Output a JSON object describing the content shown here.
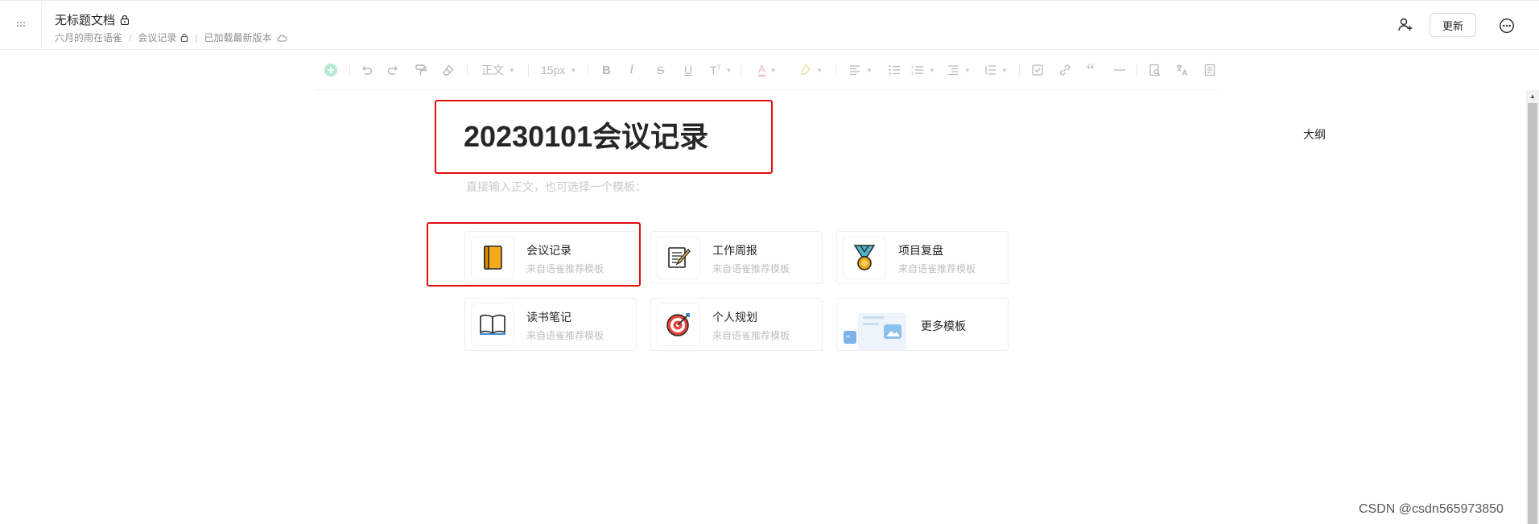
{
  "header": {
    "doc_title": "无标题文档",
    "breadcrumb": {
      "space": "六月的雨在语雀",
      "book": "会议记录",
      "status": "已加载最新版本"
    },
    "update_label": "更新"
  },
  "toolbar": {
    "paragraph_style": "正文",
    "font_size": "15px"
  },
  "editor": {
    "title": "20230101会议记录",
    "placeholder": "直接输入正文，也可选择一个模板："
  },
  "outline_label": "大纲",
  "templates": [
    {
      "name": "会议记录",
      "source": "来自语雀推荐模板",
      "icon": "notebook-icon"
    },
    {
      "name": "工作周报",
      "source": "来自语雀推荐模板",
      "icon": "memo-icon"
    },
    {
      "name": "项目复盘",
      "source": "来自语雀推荐模板",
      "icon": "medal-icon"
    },
    {
      "name": "读书笔记",
      "source": "来自语雀推荐模板",
      "icon": "open-book-icon"
    },
    {
      "name": "个人规划",
      "source": "来自语雀推荐模板",
      "icon": "target-icon"
    },
    {
      "name": "更多模板",
      "icon": "template-preview-icon"
    }
  ],
  "watermark": "CSDN @csdn565973850",
  "colors": {
    "highlight": "#e30e0e",
    "accent_green": "#00b96b"
  }
}
